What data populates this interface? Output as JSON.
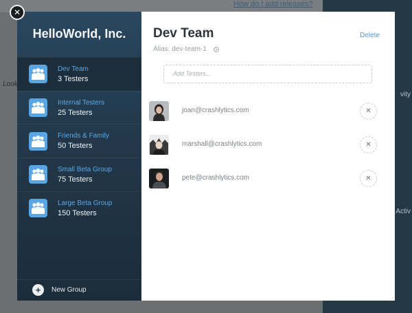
{
  "background": {
    "link_text": "How do I add releases?",
    "left_text": "Look",
    "right_text_1": "vity",
    "right_text_2": "Activ"
  },
  "modal": {
    "close_icon": "close-icon",
    "organization": "HelloWorld, Inc.",
    "groups": [
      {
        "name": "Dev Team",
        "count": "3 Testers",
        "active": true
      },
      {
        "name": "Internal Testers",
        "count": "25 Testers",
        "active": false
      },
      {
        "name": "Friends & Family",
        "count": "50 Testers",
        "active": false
      },
      {
        "name": "Small Beta Group",
        "count": "75 Testers",
        "active": false
      },
      {
        "name": "Large Beta Group",
        "count": "150 Testers",
        "active": false
      }
    ],
    "new_group_label": "New Group",
    "team": {
      "title": "Dev Team",
      "delete_label": "Delete",
      "alias": "Alias: dev-team-1",
      "add_placeholder": "Add Testers...",
      "testers": [
        {
          "email": "joan@crashlytics.com"
        },
        {
          "email": "marshall@crashlytics.com"
        },
        {
          "email": "pete@crashlytics.com"
        }
      ]
    }
  },
  "colors": {
    "accent": "#5da7e4",
    "sidebar": "#22384a",
    "link": "#5396cf"
  }
}
